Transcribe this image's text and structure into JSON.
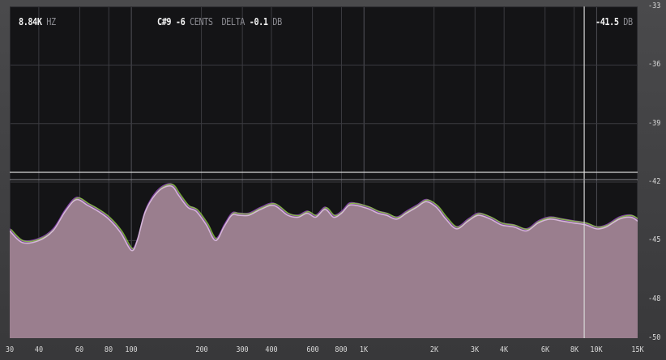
{
  "readouts": {
    "frequency_value": "8.84K",
    "frequency_unit": "HZ",
    "note_value": "C#9",
    "cents_value": "-6",
    "cents_unit": "CENTS",
    "delta_label": "DELTA",
    "delta_value": "-0.1",
    "delta_unit": "DB",
    "level_value": "-41.5",
    "level_unit": "DB"
  },
  "colors": {
    "background": "#141416",
    "spectrum_fill": "#9a7e8e",
    "spectrum_edge": "#d6b8d8",
    "overlay_purple": "#7d3fa0",
    "overlay_green": "#8ad13a",
    "grid": "#3b3b40",
    "cursor": "#d8d8d8"
  },
  "chart_data": {
    "type": "area",
    "x_scale": "log",
    "xlim": [
      30,
      15000
    ],
    "ylim": [
      -50,
      -33
    ],
    "grid": true,
    "y_ticks": [
      "-33",
      "-36",
      "-39",
      "-42",
      "-45",
      "-48",
      "-50"
    ],
    "y_tick_values": [
      -33,
      -36,
      -39,
      -42,
      -45,
      -48,
      -50
    ],
    "x_ticks": [
      "30",
      "40",
      "60",
      "80",
      "100",
      "200",
      "300",
      "400",
      "600",
      "800",
      "1K",
      "2K",
      "3K",
      "4K",
      "6K",
      "8K",
      "10K",
      "15K"
    ],
    "x_tick_values": [
      30,
      40,
      60,
      80,
      100,
      200,
      300,
      400,
      600,
      800,
      1000,
      2000,
      3000,
      4000,
      6000,
      8000,
      10000,
      15000
    ],
    "cursor": {
      "frequency_hz": 8840,
      "level_db": -41.5
    },
    "series": [
      {
        "x": [
          30,
          34,
          40,
          46,
          52,
          58,
          65,
          72,
          80,
          90,
          100,
          106,
          115,
          130,
          148,
          160,
          175,
          190,
          210,
          230,
          250,
          270,
          290,
          320,
          360,
          410,
          470,
          520,
          570,
          620,
          680,
          740,
          800,
          860,
          930,
          1000,
          1060,
          1150,
          1250,
          1380,
          1520,
          1680,
          1850,
          2050,
          2250,
          2500,
          2800,
          3100,
          3500,
          3900,
          4400,
          5000,
          5600,
          6300,
          7100,
          8000,
          9000,
          10000,
          11000,
          12500,
          14000,
          15000
        ],
        "y": [
          -44.5,
          -45.1,
          -45.0,
          -44.5,
          -43.5,
          -42.9,
          -43.2,
          -43.5,
          -43.9,
          -44.6,
          -45.5,
          -45.0,
          -43.5,
          -42.5,
          -42.2,
          -42.7,
          -43.3,
          -43.5,
          -44.2,
          -45.0,
          -44.3,
          -43.7,
          -43.7,
          -43.7,
          -43.4,
          -43.2,
          -43.7,
          -43.8,
          -43.6,
          -43.8,
          -43.4,
          -43.8,
          -43.6,
          -43.2,
          -43.2,
          -43.3,
          -43.4,
          -43.6,
          -43.7,
          -43.9,
          -43.6,
          -43.3,
          -43.0,
          -43.3,
          -43.9,
          -44.4,
          -44.0,
          -43.7,
          -43.9,
          -44.2,
          -44.3,
          -44.5,
          -44.1,
          -43.9,
          -44.0,
          -44.1,
          -44.2,
          -44.4,
          -44.3,
          -43.9,
          -43.8,
          -44.0
        ]
      }
    ]
  }
}
